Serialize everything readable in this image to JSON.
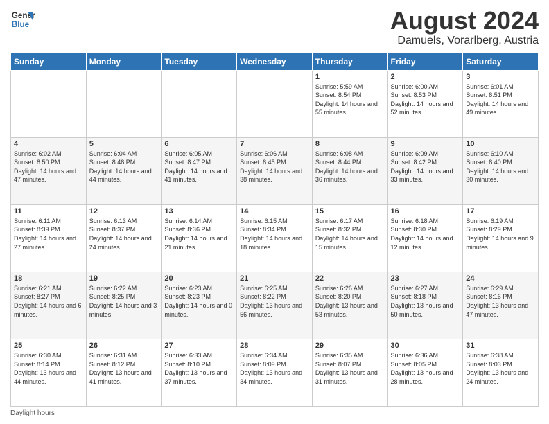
{
  "header": {
    "logo_line1": "General",
    "logo_line2": "Blue",
    "month_title": "August 2024",
    "subtitle": "Damuels, Vorarlberg, Austria"
  },
  "days_of_week": [
    "Sunday",
    "Monday",
    "Tuesday",
    "Wednesday",
    "Thursday",
    "Friday",
    "Saturday"
  ],
  "weeks": [
    [
      {
        "day": "",
        "info": ""
      },
      {
        "day": "",
        "info": ""
      },
      {
        "day": "",
        "info": ""
      },
      {
        "day": "",
        "info": ""
      },
      {
        "day": "1",
        "info": "Sunrise: 5:59 AM\nSunset: 8:54 PM\nDaylight: 14 hours and 55 minutes."
      },
      {
        "day": "2",
        "info": "Sunrise: 6:00 AM\nSunset: 8:53 PM\nDaylight: 14 hours and 52 minutes."
      },
      {
        "day": "3",
        "info": "Sunrise: 6:01 AM\nSunset: 8:51 PM\nDaylight: 14 hours and 49 minutes."
      }
    ],
    [
      {
        "day": "4",
        "info": "Sunrise: 6:02 AM\nSunset: 8:50 PM\nDaylight: 14 hours and 47 minutes."
      },
      {
        "day": "5",
        "info": "Sunrise: 6:04 AM\nSunset: 8:48 PM\nDaylight: 14 hours and 44 minutes."
      },
      {
        "day": "6",
        "info": "Sunrise: 6:05 AM\nSunset: 8:47 PM\nDaylight: 14 hours and 41 minutes."
      },
      {
        "day": "7",
        "info": "Sunrise: 6:06 AM\nSunset: 8:45 PM\nDaylight: 14 hours and 38 minutes."
      },
      {
        "day": "8",
        "info": "Sunrise: 6:08 AM\nSunset: 8:44 PM\nDaylight: 14 hours and 36 minutes."
      },
      {
        "day": "9",
        "info": "Sunrise: 6:09 AM\nSunset: 8:42 PM\nDaylight: 14 hours and 33 minutes."
      },
      {
        "day": "10",
        "info": "Sunrise: 6:10 AM\nSunset: 8:40 PM\nDaylight: 14 hours and 30 minutes."
      }
    ],
    [
      {
        "day": "11",
        "info": "Sunrise: 6:11 AM\nSunset: 8:39 PM\nDaylight: 14 hours and 27 minutes."
      },
      {
        "day": "12",
        "info": "Sunrise: 6:13 AM\nSunset: 8:37 PM\nDaylight: 14 hours and 24 minutes."
      },
      {
        "day": "13",
        "info": "Sunrise: 6:14 AM\nSunset: 8:36 PM\nDaylight: 14 hours and 21 minutes."
      },
      {
        "day": "14",
        "info": "Sunrise: 6:15 AM\nSunset: 8:34 PM\nDaylight: 14 hours and 18 minutes."
      },
      {
        "day": "15",
        "info": "Sunrise: 6:17 AM\nSunset: 8:32 PM\nDaylight: 14 hours and 15 minutes."
      },
      {
        "day": "16",
        "info": "Sunrise: 6:18 AM\nSunset: 8:30 PM\nDaylight: 14 hours and 12 minutes."
      },
      {
        "day": "17",
        "info": "Sunrise: 6:19 AM\nSunset: 8:29 PM\nDaylight: 14 hours and 9 minutes."
      }
    ],
    [
      {
        "day": "18",
        "info": "Sunrise: 6:21 AM\nSunset: 8:27 PM\nDaylight: 14 hours and 6 minutes."
      },
      {
        "day": "19",
        "info": "Sunrise: 6:22 AM\nSunset: 8:25 PM\nDaylight: 14 hours and 3 minutes."
      },
      {
        "day": "20",
        "info": "Sunrise: 6:23 AM\nSunset: 8:23 PM\nDaylight: 14 hours and 0 minutes."
      },
      {
        "day": "21",
        "info": "Sunrise: 6:25 AM\nSunset: 8:22 PM\nDaylight: 13 hours and 56 minutes."
      },
      {
        "day": "22",
        "info": "Sunrise: 6:26 AM\nSunset: 8:20 PM\nDaylight: 13 hours and 53 minutes."
      },
      {
        "day": "23",
        "info": "Sunrise: 6:27 AM\nSunset: 8:18 PM\nDaylight: 13 hours and 50 minutes."
      },
      {
        "day": "24",
        "info": "Sunrise: 6:29 AM\nSunset: 8:16 PM\nDaylight: 13 hours and 47 minutes."
      }
    ],
    [
      {
        "day": "25",
        "info": "Sunrise: 6:30 AM\nSunset: 8:14 PM\nDaylight: 13 hours and 44 minutes."
      },
      {
        "day": "26",
        "info": "Sunrise: 6:31 AM\nSunset: 8:12 PM\nDaylight: 13 hours and 41 minutes."
      },
      {
        "day": "27",
        "info": "Sunrise: 6:33 AM\nSunset: 8:10 PM\nDaylight: 13 hours and 37 minutes."
      },
      {
        "day": "28",
        "info": "Sunrise: 6:34 AM\nSunset: 8:09 PM\nDaylight: 13 hours and 34 minutes."
      },
      {
        "day": "29",
        "info": "Sunrise: 6:35 AM\nSunset: 8:07 PM\nDaylight: 13 hours and 31 minutes."
      },
      {
        "day": "30",
        "info": "Sunrise: 6:36 AM\nSunset: 8:05 PM\nDaylight: 13 hours and 28 minutes."
      },
      {
        "day": "31",
        "info": "Sunrise: 6:38 AM\nSunset: 8:03 PM\nDaylight: 13 hours and 24 minutes."
      }
    ]
  ],
  "footer": {
    "note": "Daylight hours"
  }
}
